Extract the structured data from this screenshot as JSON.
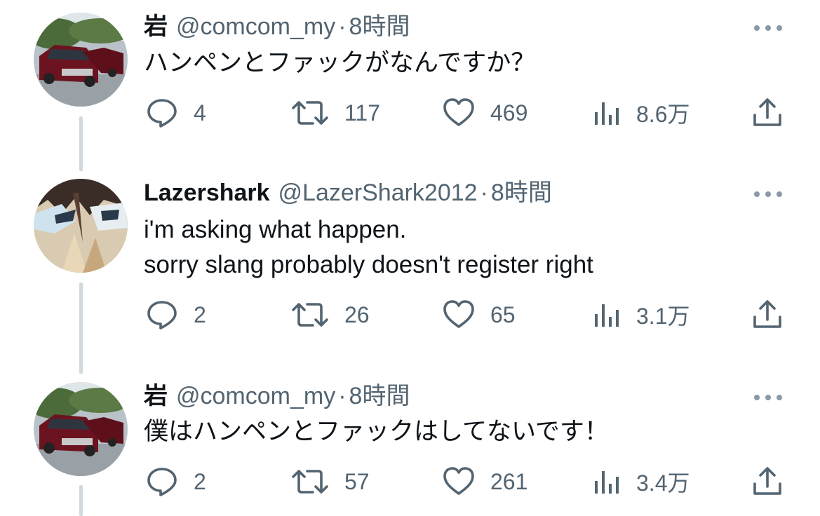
{
  "tweets": [
    {
      "name": "岩",
      "handle": "@comcom_my",
      "dot": "·",
      "time": "8時間",
      "text": "ハンペンとファックがなんですか？",
      "avatar": "car-avatar",
      "replies": "4",
      "retweets": "117",
      "likes": "469",
      "views": "8.6万"
    },
    {
      "name": "Lazershark",
      "handle": "@LazerShark2012",
      "dot": "·",
      "time": "8時間",
      "text": "i'm asking what happen.\nsorry slang probably doesn't register right",
      "avatar": "anime-avatar",
      "replies": "2",
      "retweets": "26",
      "likes": "65",
      "views": "3.1万"
    },
    {
      "name": "岩",
      "handle": "@comcom_my",
      "dot": "·",
      "time": "8時間",
      "text": "僕はハンペンとファックはしてないです！",
      "avatar": "car-avatar",
      "replies": "2",
      "retweets": "57",
      "likes": "261",
      "views": "3.4万"
    }
  ],
  "icons": {
    "reply": "reply-icon",
    "retweet": "retweet-icon",
    "like": "heart-icon",
    "views": "views-icon",
    "share": "share-icon",
    "more": "more-icon"
  },
  "colors": {
    "text": "#0f1419",
    "secondary": "#536471",
    "thread_line": "#cfd9de"
  }
}
